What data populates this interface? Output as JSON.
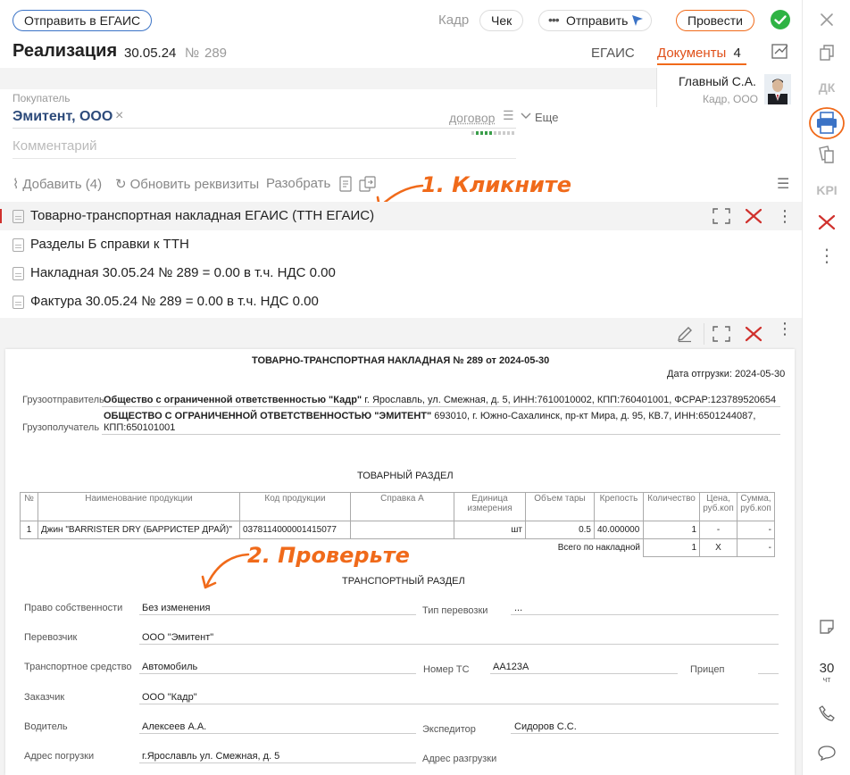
{
  "toolbar": {
    "send_egais": "Отправить в ЕГАИС",
    "kadr": "Кадр",
    "check": "Чек",
    "send": "Отправить",
    "conduct": "Провести"
  },
  "header": {
    "title": "Реализация",
    "date": "30.05.24",
    "number_prefix": "№",
    "number": "289",
    "tab_egais": "ЕГАИС",
    "tab_docs": "Документы",
    "tab_docs_count": "4"
  },
  "user": {
    "name": "Главный С.А.",
    "org": "Кадр, ООО"
  },
  "buyer": {
    "label": "Покупатель",
    "value": "Эмитент, ООО",
    "contract": "договор",
    "more": "Еще",
    "comment_placeholder": "Комментарий"
  },
  "actions": {
    "add": "Добавить (4)",
    "refresh": "Обновить реквизиты",
    "parse": "Разобрать"
  },
  "documents": [
    "Товарно-транспортная накладная ЕГАИС (ТТН ЕГАИС)",
    "Разделы Б справки к ТТН",
    "Накладная 30.05.24 № 289 = 0.00 в т.ч. НДС 0.00",
    "Фактура 30.05.24 № 289 = 0.00 в т.ч. НДС 0.00"
  ],
  "annotations": {
    "step1": "1. Кликните",
    "step2": "2. Проверьте"
  },
  "preview": {
    "title": "ТОВАРНО-ТРАНСПОРТНАЯ НАКЛАДНАЯ № 289 от 2024-05-30",
    "ship_date": "Дата отгрузки: 2024-05-30",
    "shipper_label": "Грузоотправитель",
    "shipper_name": "Общество с ограниченной ответственностью \"Кадр\"",
    "shipper_rest": " г. Ярославль, ул. Смежная, д. 5, ИНН:7610010002, КПП:760401001, ФСРАР:123789520654",
    "consignee_label": "Грузополучатель",
    "consignee_name": "ОБЩЕСТВО С ОГРАНИЧЕННОЙ ОТВЕТСТВЕННОСТЬЮ \"ЭМИТЕНТ\"",
    "consignee_rest": " 693010, г. Южно-Сахалинск, пр-кт Мира, д. 95, КВ.7, ИНН:6501244087,",
    "consignee_kpp": "КПП:650101001",
    "goods_section": "ТОВАРНЫЙ РАЗДЕЛ",
    "columns": [
      "№",
      "Наименование продукции",
      "Код продукции",
      "Справка А",
      "Единица измерения",
      "Объем тары",
      "Крепость",
      "Количество",
      "Цена, руб.коп",
      "Сумма, руб.коп"
    ],
    "row": [
      "1",
      "Джин \"BARRISTER DRY (БАРРИСТЕР ДРАЙ)\"",
      "0378114000001415077",
      "",
      "шт",
      "0.5",
      "40.000000",
      "1",
      "-",
      "-"
    ],
    "total_label": "Всего по накладной",
    "total": [
      "1",
      "X",
      "-"
    ],
    "transport_section": "ТРАНСПОРТНЫЙ РАЗДЕЛ",
    "fields": {
      "ownership_label": "Право собственности",
      "ownership": "Без изменения",
      "transport_type_label": "Тип перевозки",
      "transport_type": "...",
      "carrier_label": "Перевозчик",
      "carrier": "ООО \"Эмитент\"",
      "vehicle_label": "Транспортное средство",
      "vehicle": "Автомобиль",
      "plate_label": "Номер ТС",
      "plate": "АА123А",
      "trailer_label": "Прицеп",
      "customer_label": "Заказчик",
      "customer": "ООО \"Кадр\"",
      "driver_label": "Водитель",
      "driver": "Алексеев А.А.",
      "forwarder_label": "Экспедитор",
      "forwarder": "Сидоров С.С.",
      "load_addr_label": "Адрес погрузки",
      "load_addr": "г.Ярославль ул. Смежная, д. 5",
      "unload_addr_label": "Адрес разгрузки"
    }
  },
  "rightbar": {
    "dk": "ДК",
    "kpi": "KPI",
    "days": "30",
    "days_unit": "чт"
  },
  "colors": {
    "accent_orange": "#f06a1a",
    "accent_blue": "#3b73c6",
    "ok_green": "#2fb344",
    "delete_red": "#d0312d"
  }
}
